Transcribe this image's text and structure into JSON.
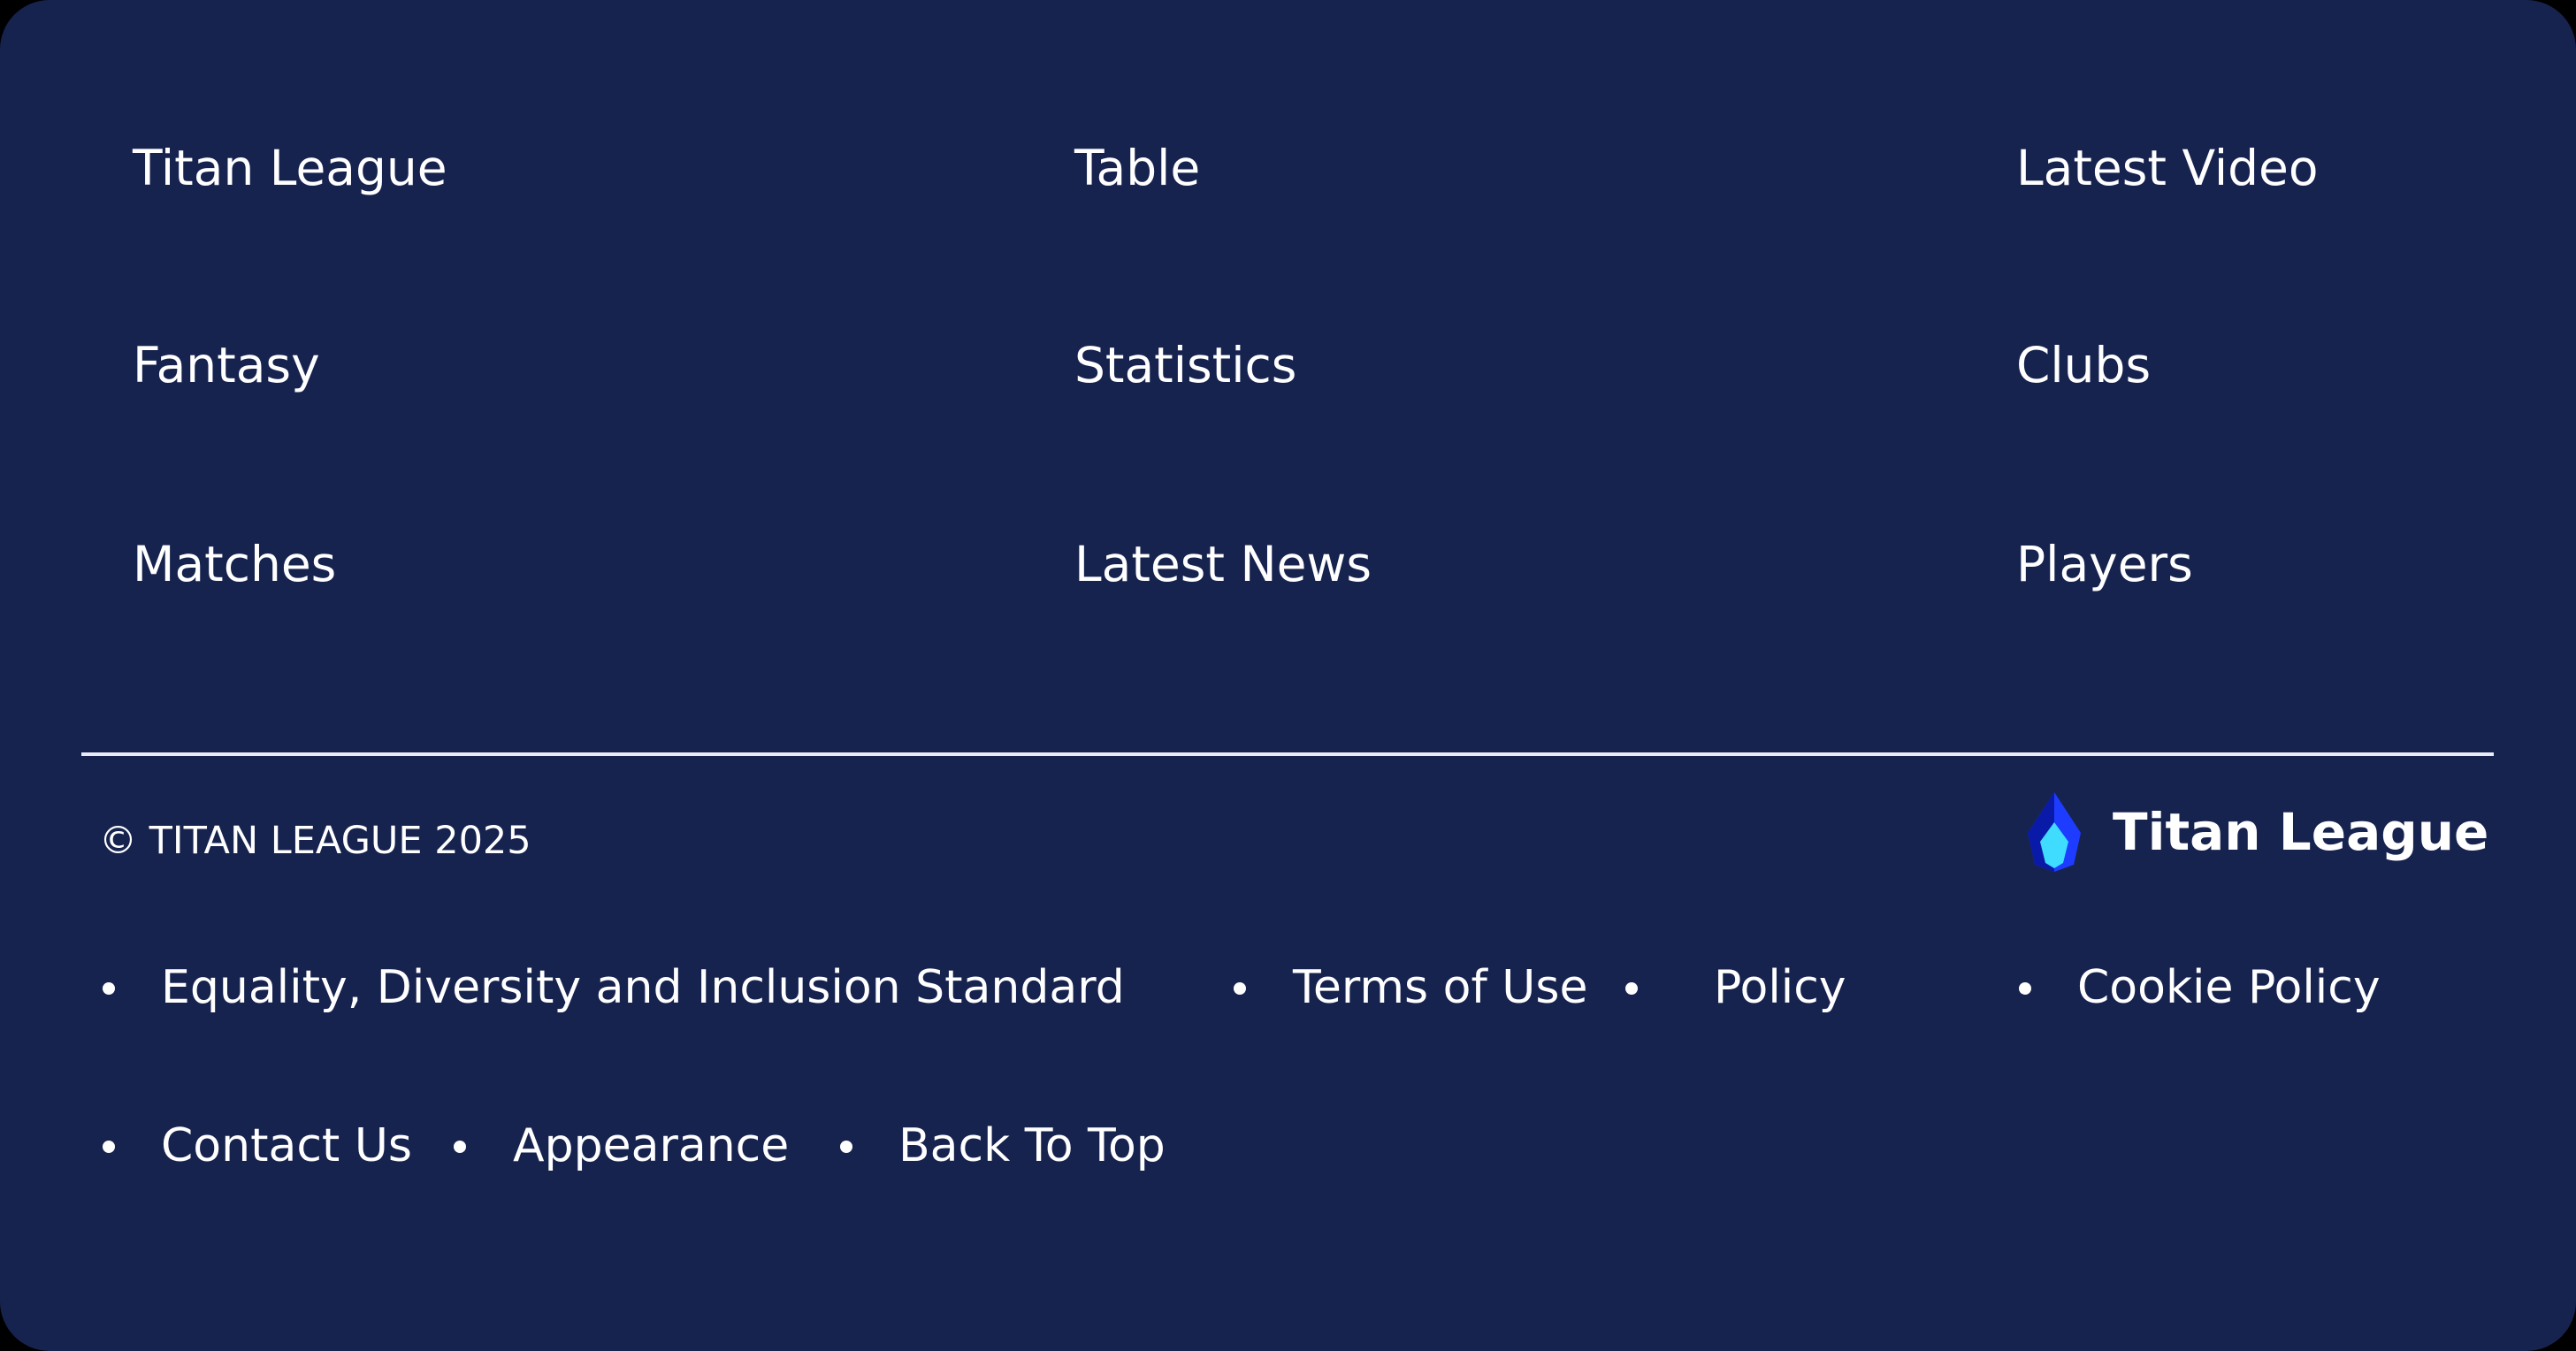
{
  "nav": {
    "col1": [
      "Titan League",
      "Fantasy",
      "Matches"
    ],
    "col2": [
      "Table",
      "Statistics",
      "Latest News"
    ],
    "col3": [
      "Latest Video",
      "Clubs",
      "Players"
    ]
  },
  "copyright": "© TITAN LEAGUE 2025",
  "brand": {
    "name": "Titan League",
    "logo_icon": "flame-crystal-logo",
    "logo_colors": [
      "#1d3cff",
      "#0a1aa8",
      "#3fdcff"
    ]
  },
  "legal_links": {
    "row1": [
      "Equality, Diversity and Inclusion Standard",
      "Terms of Use",
      "Policy",
      "Cookie Policy"
    ],
    "row2": [
      "Contact Us",
      "Appearance",
      "Back To Top"
    ]
  },
  "colors": {
    "background": "#17234f",
    "text": "#ffffff",
    "divider": "#e9ecf5"
  }
}
